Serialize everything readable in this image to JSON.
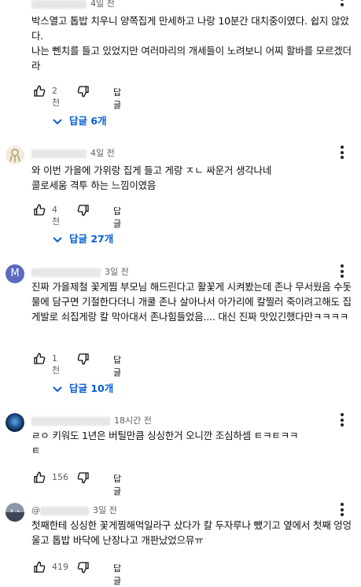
{
  "comments": [
    {
      "time": "4일 전",
      "text": "박스열고 톱밥 치우니 양쪽집게 만세하고 나랑 10분간 대치중이였다. 쉽지 않았다.\n나는 뻰치를 들고 있었지만 여러마리의 개세들이 노려보니 어찌 할바를 모르겠더라",
      "likes": "2천",
      "reply_label": "답글",
      "replies_label": "답글 6개"
    },
    {
      "time": "4일 전",
      "text": "와 이번 가을에 가위랑 집게 들고 게랑 ㅈㄴ 싸운거 생각나네\n콜로세움 격투 하는 느낌이였음",
      "likes": "4천",
      "reply_label": "답글",
      "replies_label": "답글 27개"
    },
    {
      "avatar_letter": "M",
      "time": "3일 전",
      "text": "진짜 가을제철 꽃게찜 부모님 해드린다고 활꽃게 시켜봤는데 존나 무서웠음 수돗물에 담구면 기절한다더니 개쿨 존나 살아나서 아가리에 칼찔러 죽이려고해도 집게발로 쇠집게랑 칼 막아대서 존나힘들었음.... 대신 진짜 맛있긴했다만ㅋㅋㅋㅋ",
      "likes": "1천",
      "reply_label": "답글",
      "replies_label": "답글 10개"
    },
    {
      "time": "18시간 전",
      "text": "ㄹㅇ 키워도 1년은 버틸만큼 싱싱한거 오니깐 조심하셈 ㅌㅋㅌㅋㅋ\nㅌ",
      "likes": "156",
      "reply_label": "답글"
    },
    {
      "name_prefix": "@",
      "time": "3일 전",
      "text": "첫째한테 싱싱한 꽃게찜해먹일라구 샀다가 칼 두자루나 뺐기고 옆에서 첫째 엉엉울고 톱밥 바닥에 난장나고 개판났었으뮤ㅠ",
      "likes": "419",
      "reply_label": "답글"
    }
  ],
  "colors": {
    "link": "#065fd4",
    "meta": "#606060",
    "text": "#0f0f0f",
    "avatar_m": "#5c6bc0"
  }
}
